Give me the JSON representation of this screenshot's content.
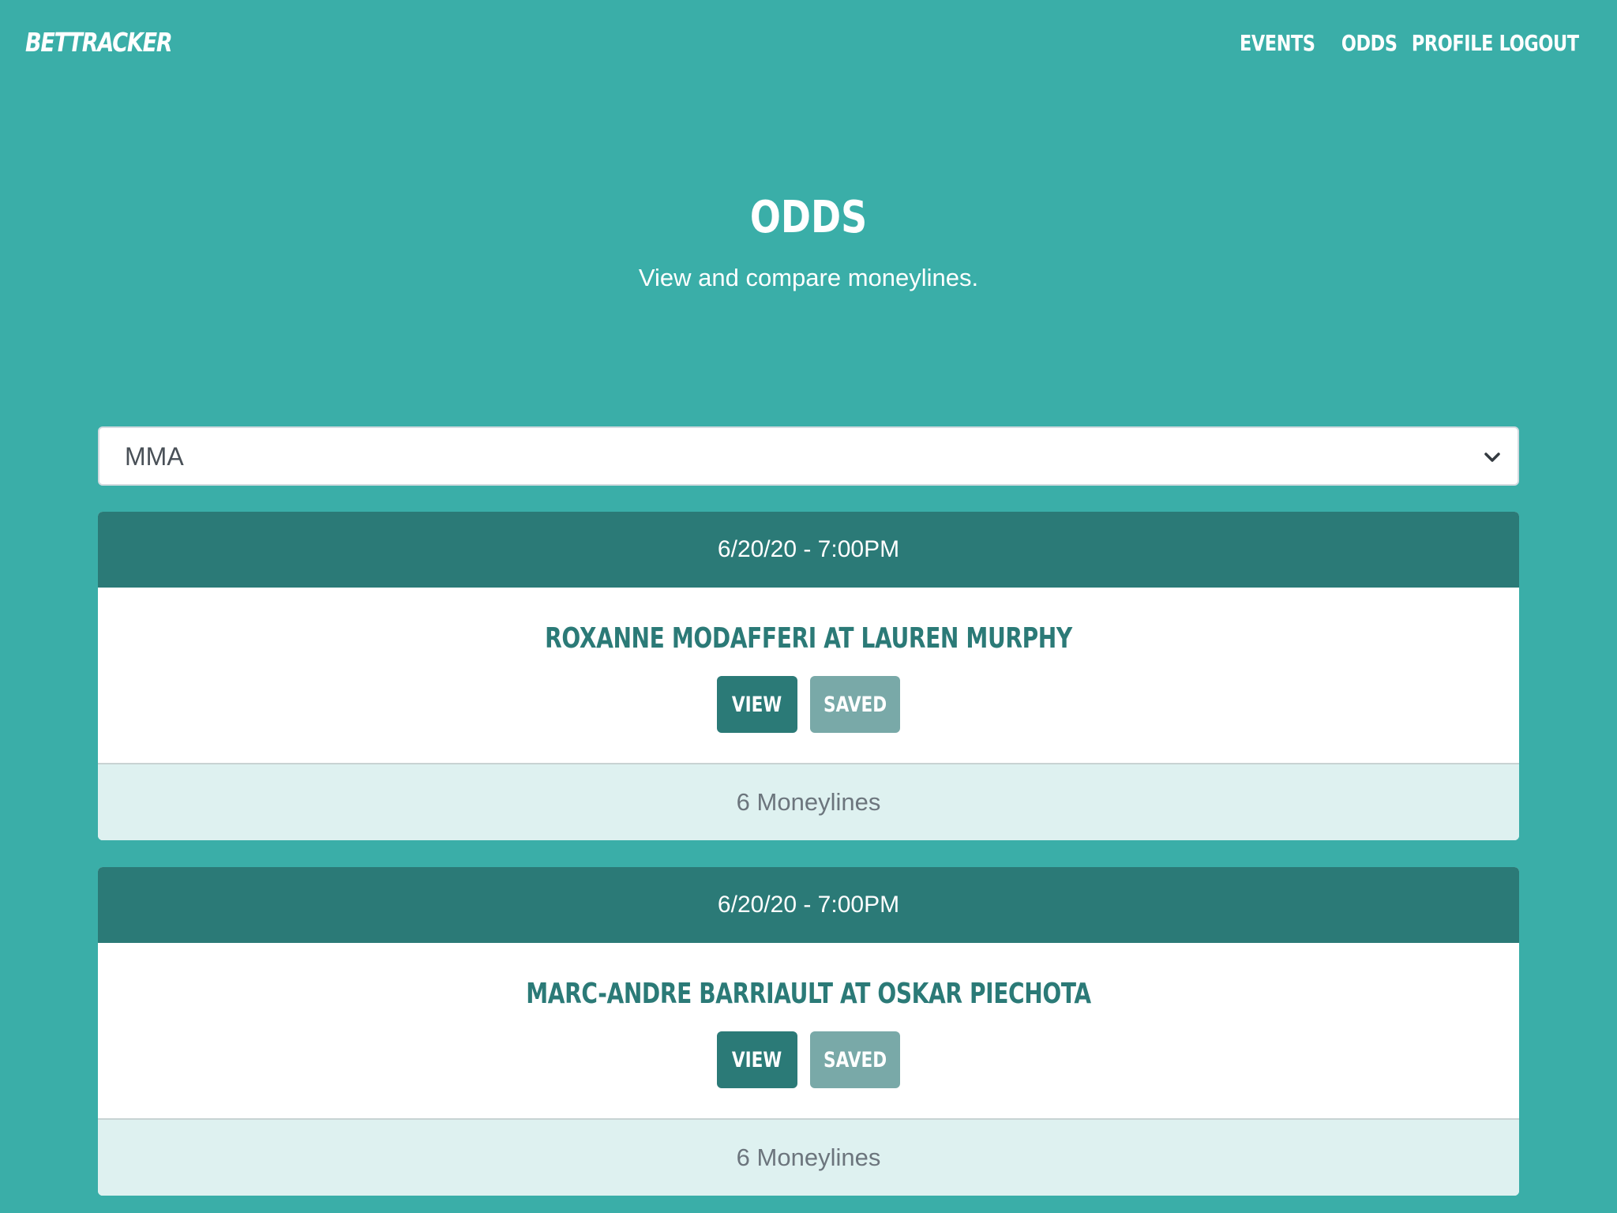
{
  "brand": "BETTRACKER",
  "nav": {
    "items": [
      {
        "label": "EVENTS"
      },
      {
        "label": "ODDS"
      },
      {
        "label": "PROFILE"
      },
      {
        "label": "LOGOUT"
      }
    ]
  },
  "hero": {
    "title": "ODDS",
    "subtitle": "View and compare moneylines."
  },
  "filter": {
    "selected": "MMA"
  },
  "events": [
    {
      "datetime": "6/20/20 - 7:00PM",
      "matchup": "ROXANNE MODAFFERI AT LAUREN MURPHY",
      "view_label": "VIEW",
      "saved_label": "SAVED",
      "footer": "6 Moneylines"
    },
    {
      "datetime": "6/20/20 - 7:00PM",
      "matchup": "MARC-ANDRE BARRIAULT AT OSKAR PIECHOTA",
      "view_label": "VIEW",
      "saved_label": "SAVED",
      "footer": "6 Moneylines"
    }
  ],
  "colors": {
    "background": "#3aaea8",
    "primary_dark": "#2b7a77",
    "saved_button": "#79a9a8",
    "footer_bg": "#def1f0"
  }
}
